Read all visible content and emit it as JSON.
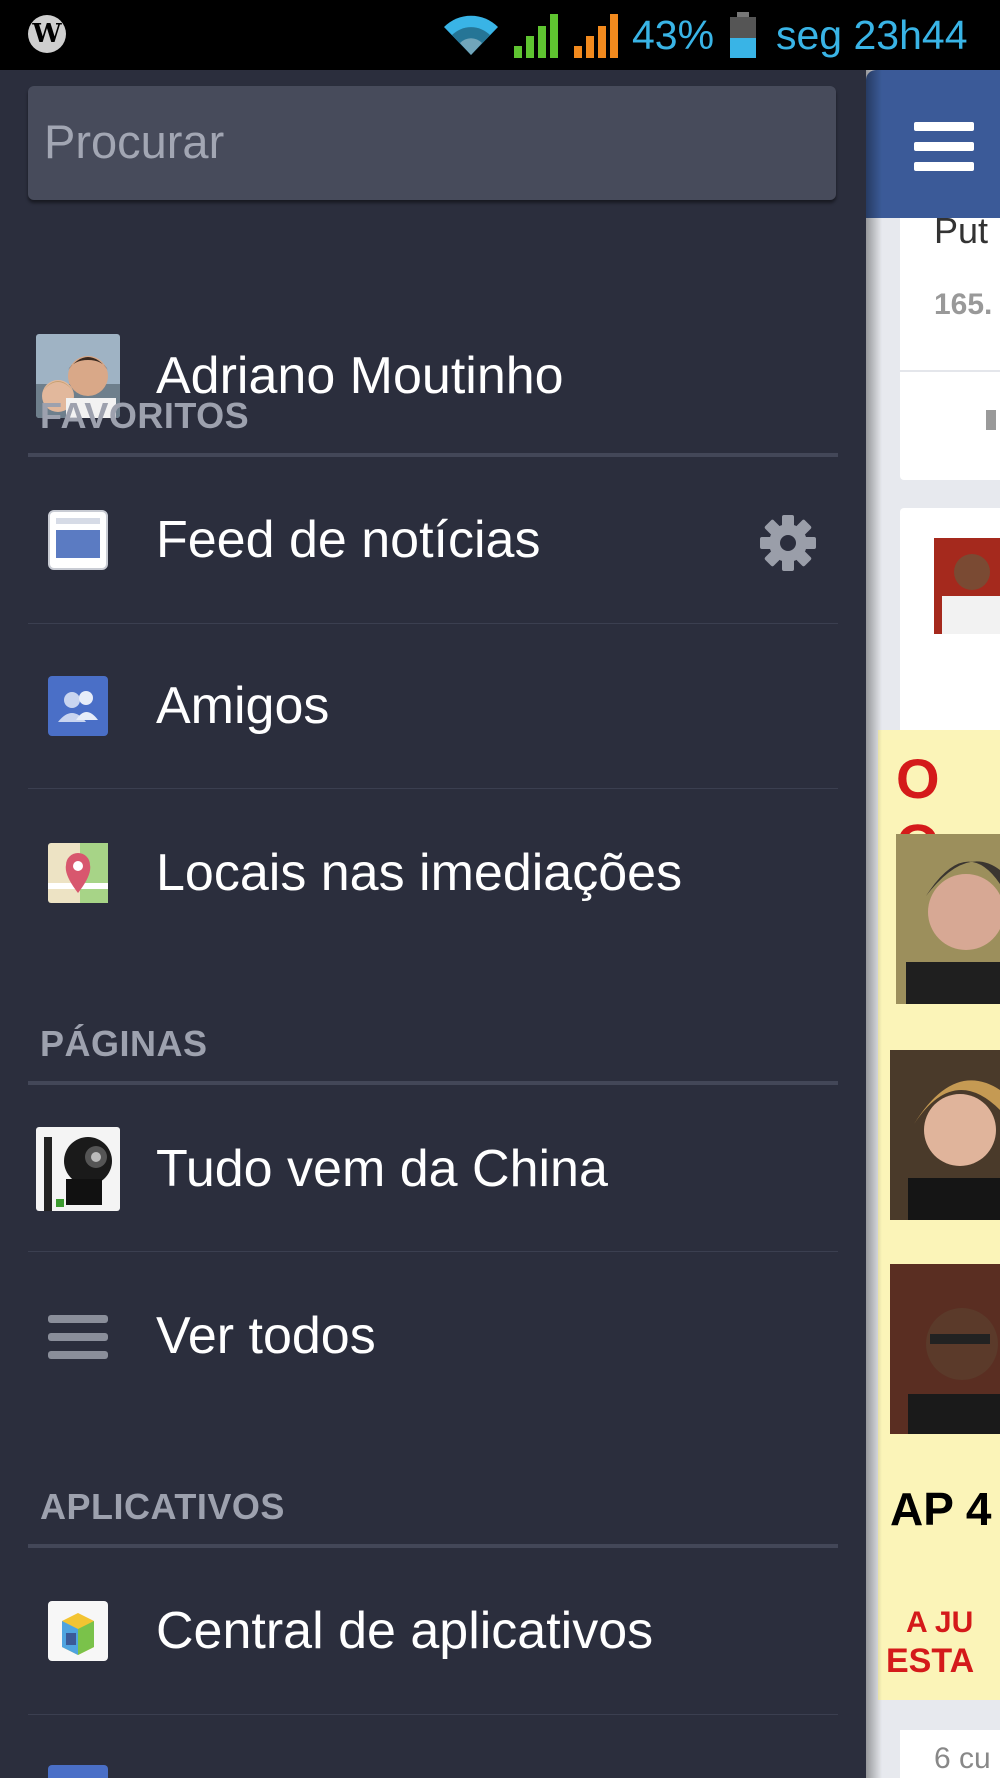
{
  "status_bar": {
    "battery_percent": "43%",
    "clock": "seg 23h44",
    "icons": [
      "wordpress-icon",
      "wifi-icon",
      "signal-icon",
      "signal-icon",
      "battery-icon"
    ],
    "accent_color": "#39b4e6"
  },
  "drawer": {
    "search": {
      "placeholder": "Procurar"
    },
    "profile": {
      "name": "Adriano Moutinho"
    },
    "sections": {
      "favorites": {
        "title": "FAVORITOS",
        "items": [
          {
            "label": "Feed de notícias",
            "icon": "news-feed-icon",
            "action_icon": "gear-icon"
          },
          {
            "label": "Amigos",
            "icon": "friends-icon"
          },
          {
            "label": "Locais nas imediações",
            "icon": "map-pin-icon"
          }
        ]
      },
      "pages": {
        "title": "PÁGINAS",
        "items": [
          {
            "label": "Tudo vem da China",
            "icon": "page-thumbnail"
          },
          {
            "label": "Ver todos",
            "icon": "list-icon"
          }
        ]
      },
      "apps": {
        "title": "APLICATIVOS",
        "items": [
          {
            "label": "Central de aplicativos",
            "icon": "app-center-icon"
          }
        ]
      }
    },
    "background_color": "#2b2e3d"
  },
  "peek_panel": {
    "top_bar_color": "#3b5a98",
    "card1_text": "Put",
    "card1_count": "165.",
    "poster_heading": "O Q",
    "poster_ap": "AP 4",
    "poster_caption_1": "A JU",
    "poster_caption_2": "ESTA",
    "bottom_text": "6 cu"
  }
}
